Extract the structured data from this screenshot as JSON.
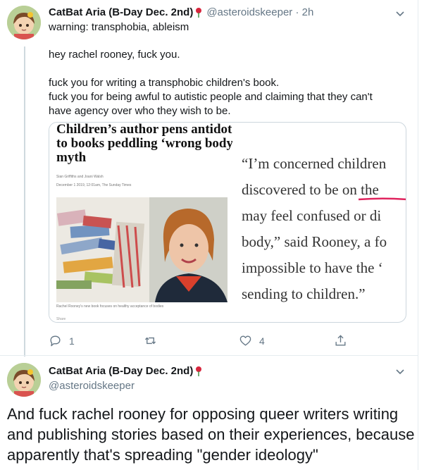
{
  "tweet1": {
    "display_name": "CatBat Aria (B-Day Dec. 2nd)",
    "handle_time": "@asteroidskeeper · 2h",
    "content_warning": "warning: transphobia, ableism",
    "lines": [
      "hey rachel rooney, fuck you.",
      "fuck you for writing a transphobic children's book.",
      "fuck you for being awful to autistic people and claiming that they can't",
      "have agency over who they wish to be."
    ],
    "card": {
      "headline": [
        "Children’s author pens antidote",
        "to books peddling ‘wrong body",
        "myth"
      ],
      "byline": "Sian Griffiths and Joani Walsh",
      "dateline": "December 1 2019, 12:01am, The Sunday Times",
      "caption": "Rachel Rooney's new book focuses on healthy acceptance of bodies",
      "share": "Share",
      "quote_lines": [
        "“I’m concerned children",
        "discovered to be on the",
        "may feel confused or di",
        "body,” said Rooney, a fo",
        "impossible to have the ‘",
        "sending to children.”"
      ]
    },
    "actions": {
      "replies": "1",
      "retweets": "",
      "likes": "4"
    }
  },
  "tweet2": {
    "display_name": "CatBat Aria (B-Day Dec. 2nd)",
    "handle": "@asteroidskeeper",
    "text": "And fuck rachel rooney for opposing queer writers writing and publishing stories based on their experiences, because apparently that's spreading \"gender ideology\""
  },
  "icons": {
    "reply": "reply-icon",
    "retweet": "retweet-icon",
    "like": "heart-icon",
    "share": "share-icon",
    "more": "chevron-down-icon",
    "emoji": "rose-emoji-icon"
  },
  "colors": {
    "text": "#14171a",
    "muted": "#657786",
    "border": "#ccd6dd",
    "underline": "#e0245e"
  }
}
